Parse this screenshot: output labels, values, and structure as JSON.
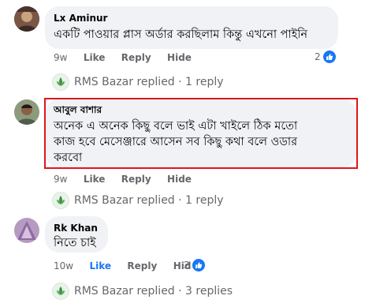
{
  "comments": [
    {
      "author": "Lx Aminur",
      "text_lines": [
        "একটি পাওয়ার প্লাস অর্ডার করছিলাম কিন্তু এখনো পাইনি"
      ],
      "time": "9w",
      "like": "Like",
      "reply": "Reply",
      "hide": "Hide",
      "reactions": "2",
      "replies_summary": {
        "page_name": "RMS Bazar",
        "text": "replied · 1 reply"
      }
    },
    {
      "author": "আবুল বাশার",
      "text_lines": [
        "অনেক এ অনেক কিছু বলে ভাই এটা খাইলে ঠিক মতো",
        "কাজ হবে মেসেঞ্জারে আসেন সব কিছু কথা বলে ওডার",
        "করবো"
      ],
      "time": "9w",
      "like": "Like",
      "reply": "Reply",
      "hide": "Hide",
      "replies_summary": {
        "page_name": "RMS Bazar",
        "text": "replied · 1 reply"
      }
    },
    {
      "author": "Rk Khan",
      "text_lines": [
        "নিতে চাই"
      ],
      "time": "10w",
      "like": "Like",
      "reply": "Reply",
      "hide": "Hide",
      "reactions": "2",
      "replies_summary": {
        "page_name": "RMS Bazar",
        "text": "replied · 3 replies"
      }
    }
  ],
  "colors": {
    "highlight_border": "#e1141b",
    "like_blue": "#1877f2",
    "bubble": "#f0f2f5",
    "meta_gray": "#65676b"
  },
  "icons": {
    "reaction": "like-thumb-icon",
    "page_logo": "rms-bazar-logo-icon"
  }
}
